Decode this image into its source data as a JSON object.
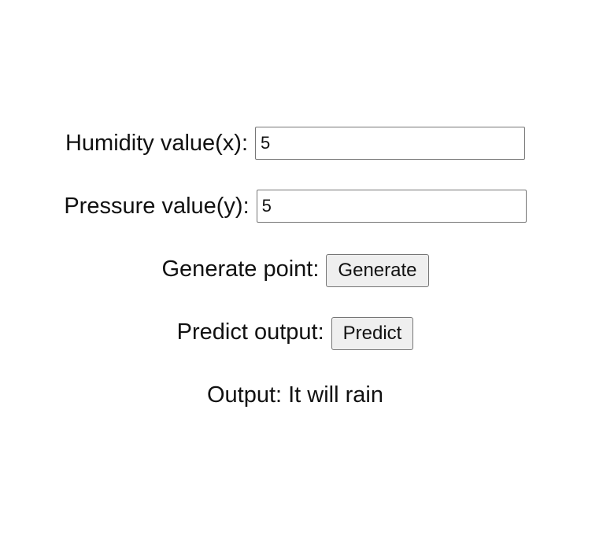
{
  "form": {
    "humidity": {
      "label": "Humidity value(x):",
      "value": "5"
    },
    "pressure": {
      "label": "Pressure value(y):",
      "value": "5"
    },
    "generate": {
      "label": "Generate point:",
      "button": "Generate"
    },
    "predict": {
      "label": "Predict output:",
      "button": "Predict"
    },
    "output": {
      "label": "Output:",
      "value": "It will rain"
    }
  }
}
